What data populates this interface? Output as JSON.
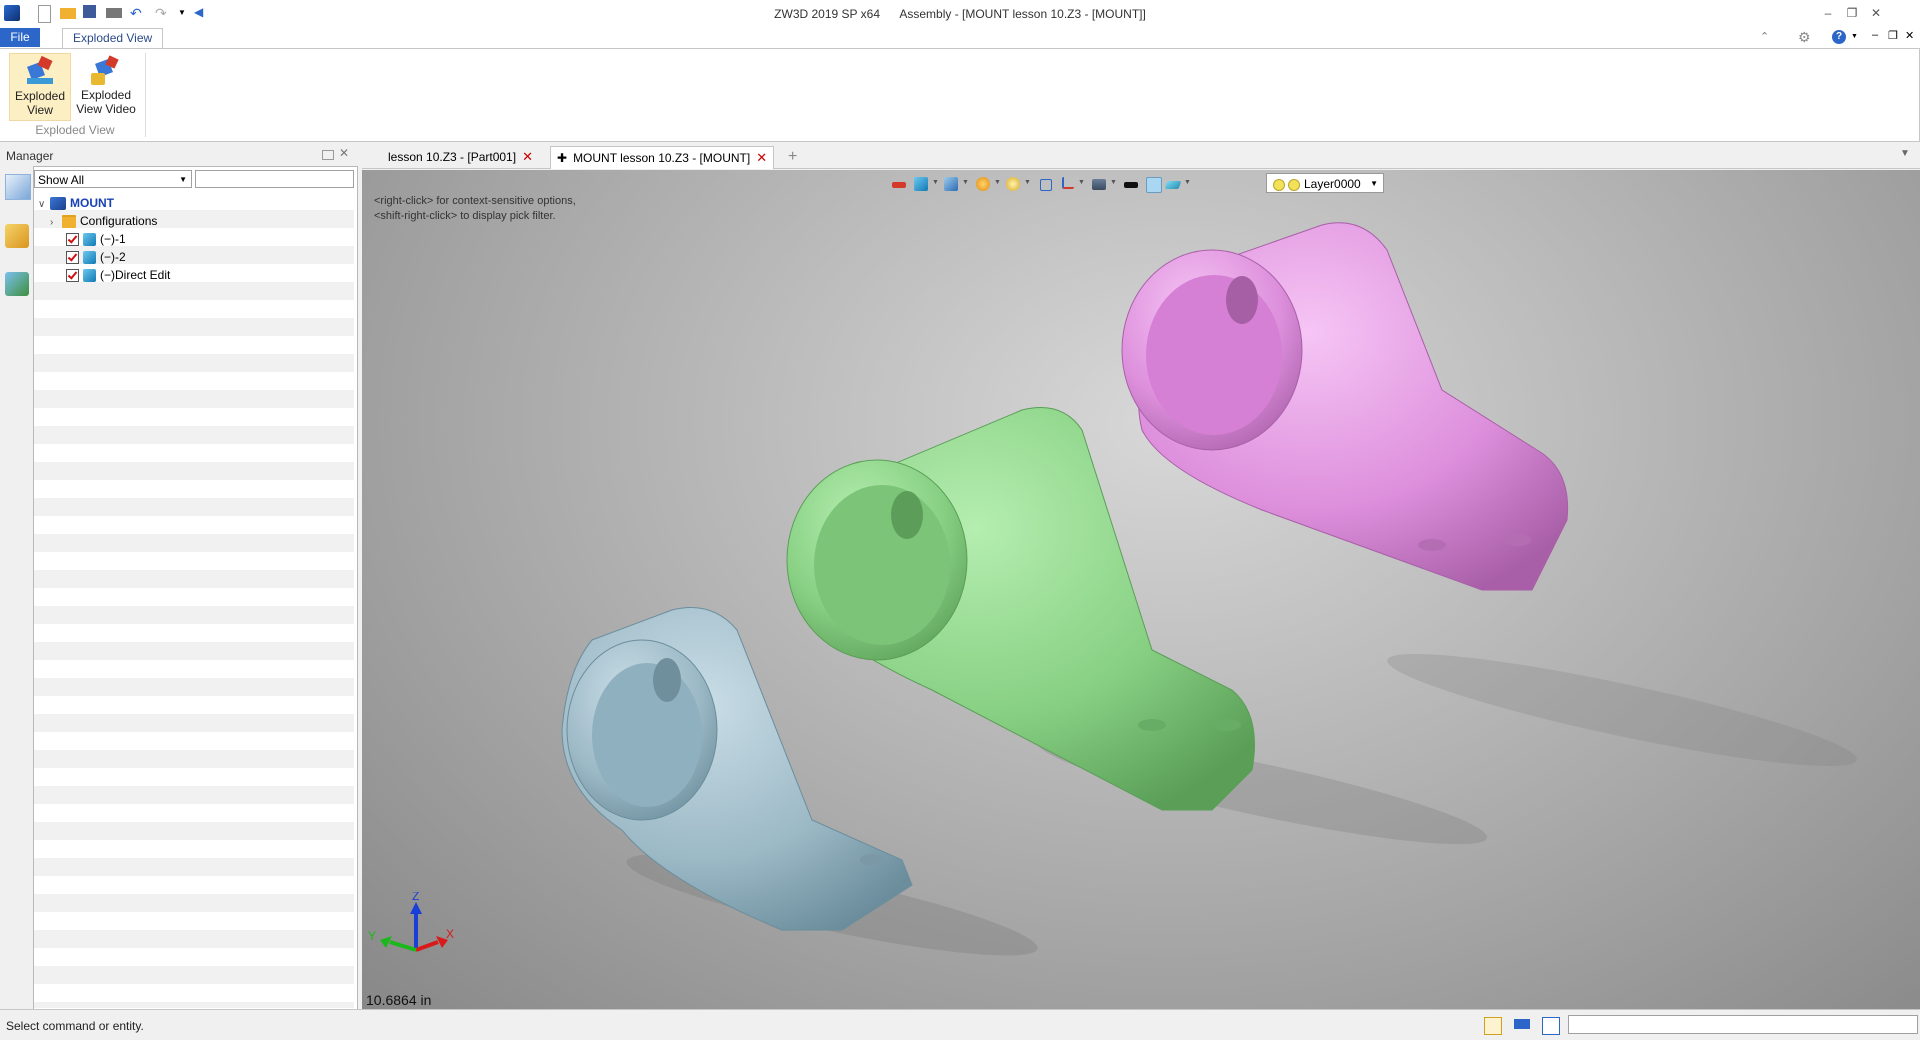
{
  "window": {
    "app_title": "ZW3D 2019 SP x64",
    "doc_title": "Assembly - [MOUNT lesson 10.Z3 - [MOUNT]]"
  },
  "ribbon": {
    "tabs": [
      {
        "label": "File",
        "active": false
      },
      {
        "label": "Exploded View",
        "active": true
      }
    ],
    "buttons": [
      {
        "label_line1": "Exploded",
        "label_line2": "View"
      },
      {
        "label_line1": "Exploded",
        "label_line2": "View Video"
      }
    ],
    "group_label": "Exploded View"
  },
  "manager": {
    "title": "Manager",
    "filter_value": "Show All",
    "search_value": "",
    "tree": {
      "root": "MOUNT",
      "items": [
        {
          "label": "Configurations",
          "type": "folder"
        },
        {
          "label": "(−)-1",
          "type": "part",
          "checked": true
        },
        {
          "label": "(−)-2",
          "type": "part",
          "checked": true
        },
        {
          "label": "(−)Direct Edit",
          "type": "part",
          "checked": true
        }
      ]
    }
  },
  "doc_tabs": [
    {
      "label": "lesson 10.Z3 - [Part001]",
      "active": false
    },
    {
      "label": "MOUNT lesson 10.Z3 - [MOUNT]",
      "active": true
    }
  ],
  "viewport": {
    "hint_line1": "<right-click> for context-sensitive options,",
    "hint_line2": "<shift-right-click> to display pick filter.",
    "layer": "Layer0000",
    "scale": "10.6864 in",
    "triad": {
      "x": "X",
      "y": "Y",
      "z": "Z"
    },
    "part_colors": {
      "blue": "#9cb9c6",
      "green": "#86cf82",
      "pink": "#dd8fdc"
    }
  },
  "status": {
    "text": "Select command or entity."
  },
  "colors": {
    "accent": "#2b66c8",
    "ribbon_active": "#fdefc4"
  }
}
